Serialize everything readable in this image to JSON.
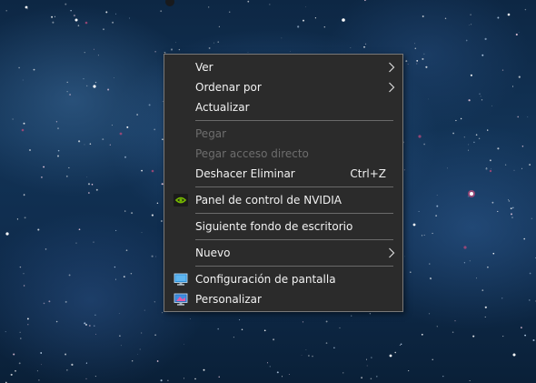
{
  "context_menu": {
    "items": [
      {
        "label": "Ver",
        "submenu": true,
        "enabled": true
      },
      {
        "label": "Ordenar por",
        "submenu": true,
        "enabled": true
      },
      {
        "label": "Actualizar",
        "enabled": true
      },
      {
        "label": "Pegar",
        "enabled": false
      },
      {
        "label": "Pegar acceso directo",
        "enabled": false
      },
      {
        "label": "Deshacer Eliminar",
        "shortcut": "Ctrl+Z",
        "enabled": true
      },
      {
        "label": "Panel de control de NVIDIA",
        "icon": "nvidia-icon",
        "enabled": true
      },
      {
        "label": "Siguiente fondo de escritorio",
        "enabled": true
      },
      {
        "label": "Nuevo",
        "submenu": true,
        "enabled": true
      },
      {
        "label": "Configuración de pantalla",
        "icon": "display-settings-icon",
        "enabled": true
      },
      {
        "label": "Personalizar",
        "icon": "personalize-icon",
        "enabled": true
      }
    ]
  },
  "colors": {
    "menu_background": "#2b2b2b",
    "menu_border": "#797979",
    "text": "#f2f2f2",
    "disabled_text": "#6d6d6d",
    "separator": "#6a6a6a",
    "nvidia_green": "#76b900"
  }
}
